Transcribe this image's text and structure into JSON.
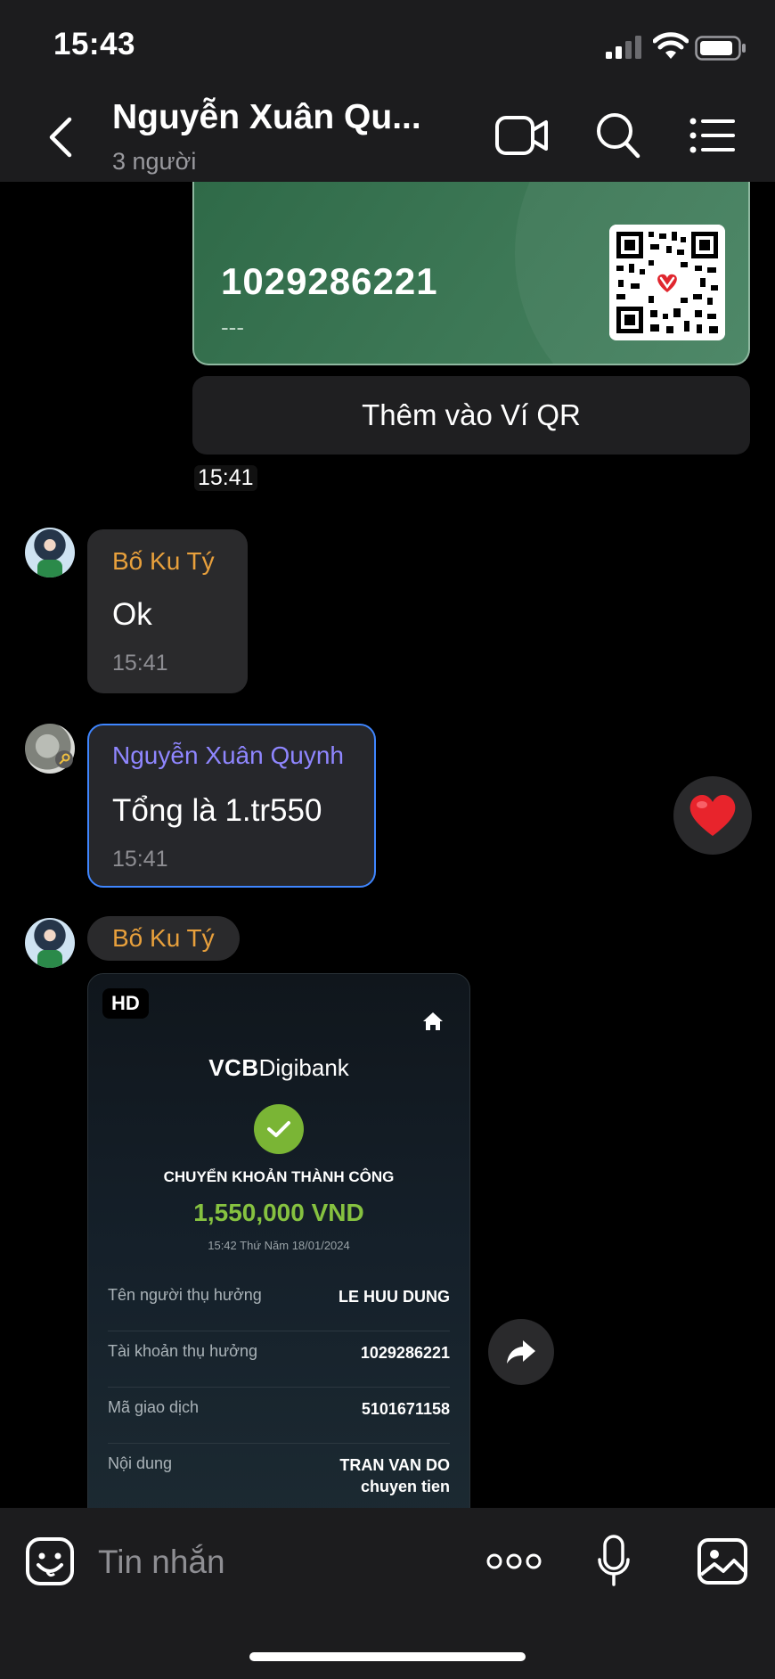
{
  "status_bar": {
    "time": "15:43"
  },
  "header": {
    "title": "Nguyễn Xuân Qu...",
    "subtitle": "3 người"
  },
  "bank_card": {
    "account_number": "1029286221",
    "account_name": "---",
    "add_button": "Thêm vào Ví QR",
    "time": "15:41"
  },
  "messages": [
    {
      "sender": "Bố Ku Tý",
      "text": "Ok",
      "time": "15:41"
    },
    {
      "sender": "Nguyễn Xuân Quynh",
      "text": "Tổng là 1.tr550",
      "time": "15:41",
      "reaction": "heart-icon"
    }
  ],
  "image_message": {
    "sender": "Bố Ku Tý",
    "badge": "HD",
    "receipt": {
      "brand_bold": "VCB",
      "brand_rest": "Digibank",
      "status": "CHUYỂN KHOẢN THÀNH CÔNG",
      "amount": "1,550,000 VND",
      "datetime": "15:42 Thứ Năm 18/01/2024",
      "rows": [
        {
          "label": "Tên người thụ hưởng",
          "value": "LE HUU DUNG"
        },
        {
          "label": "Tài khoản thụ hưởng",
          "value": "1029286221"
        },
        {
          "label": "Mã giao dịch",
          "value": "5101671158"
        },
        {
          "label": "Nội dung",
          "value": "TRAN VAN DO",
          "value2": "chuyen tien"
        }
      ]
    }
  },
  "composer": {
    "placeholder": "Tin nhắn"
  },
  "colors": {
    "sender_orange": "#e8a03c",
    "sender_purple": "#8f86ff",
    "highlight_border": "#3f86ff",
    "amount_green": "#86c240",
    "card_green": "#3d7856"
  }
}
